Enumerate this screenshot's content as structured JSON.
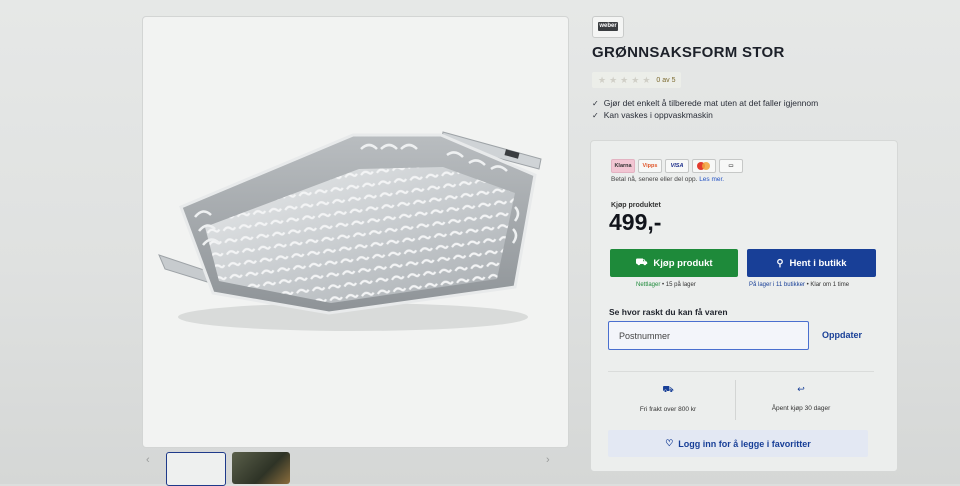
{
  "product": {
    "brand_logo": "weber",
    "title": "GRØNNSAKSFORM STOR",
    "rating_text": "0 av 5",
    "rating_value": 0,
    "rating_max": 5,
    "bullets": [
      "Gjør det enkelt å tilberede mat uten at det faller igjennom",
      "Kan vaskes i oppvaskmaskin"
    ]
  },
  "payment": {
    "methods": [
      "Klarna",
      "Vipps",
      "VISA",
      "Mastercard",
      "Card"
    ],
    "note": "Betal nå, senere eller del opp.",
    "note_link": "Les mer."
  },
  "purchase": {
    "label": "Kjøp produktet",
    "price": "499,-",
    "buy_button": "Kjøp produkt",
    "pickup_button": "Hent i butikk",
    "online_stock_label": "Nettlager",
    "online_stock_value": "• 15 på lager",
    "store_stock_label": "På lager i 11 butikker",
    "store_stock_value": "• Klar om 1 time"
  },
  "delivery": {
    "heading": "Se hvor raskt du kan få varen",
    "zip_placeholder": "Postnummer",
    "update_button": "Oppdater"
  },
  "features": [
    {
      "icon": "truck-icon",
      "text": "Fri frakt over 800 kr"
    },
    {
      "icon": "return-arrow-icon",
      "text": "Åpent kjøp 30 dager"
    }
  ],
  "favorites_button": "Logg inn for å legge i favoritter",
  "gallery": {
    "prev_arrow": "‹",
    "next_arrow": "›"
  },
  "colors": {
    "buy_green": "#1e8a3a",
    "pickup_blue": "#183f97",
    "link_blue": "#2452c4"
  }
}
